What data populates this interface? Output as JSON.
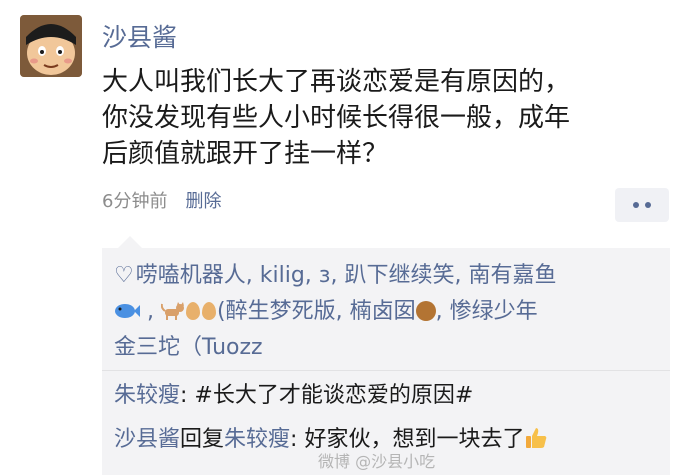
{
  "post": {
    "username": "沙县酱",
    "text_lines": [
      "大人叫我们长大了再谈恋爱是有原因的，",
      "你没发现有些人小时候长得很一般，成年",
      "后颜值就跟开了挂一样？"
    ],
    "timestamp": "6分钟前",
    "delete_label": "删除"
  },
  "likes": {
    "names": [
      "唠嗑机器人",
      "kilig",
      "з",
      "趴下继续笑",
      "南有嘉鱼",
      "(醉生梦死版",
      "楠卤囡",
      "惨绿少年",
      "金三坨（Tuozz"
    ],
    "icons": [
      "heart-icon",
      "fish-icon",
      "cat-icon",
      "egg-icon",
      "bear-icon"
    ]
  },
  "comments": [
    {
      "name": "朱较瘦",
      "sep": ": ",
      "text": "#长大了才能谈恋爱的原因#"
    },
    {
      "name": "沙县酱",
      "reply_word": "回复",
      "reply_to": "朱较瘦",
      "sep": ": ",
      "text": "好家伙，想到一块去了"
    }
  ],
  "watermark": "微博 @沙县小吃",
  "colors": {
    "link": "#576b95",
    "panel": "#f3f3f5",
    "text": "#1a1a1a",
    "meta": "#8c8c8c"
  }
}
